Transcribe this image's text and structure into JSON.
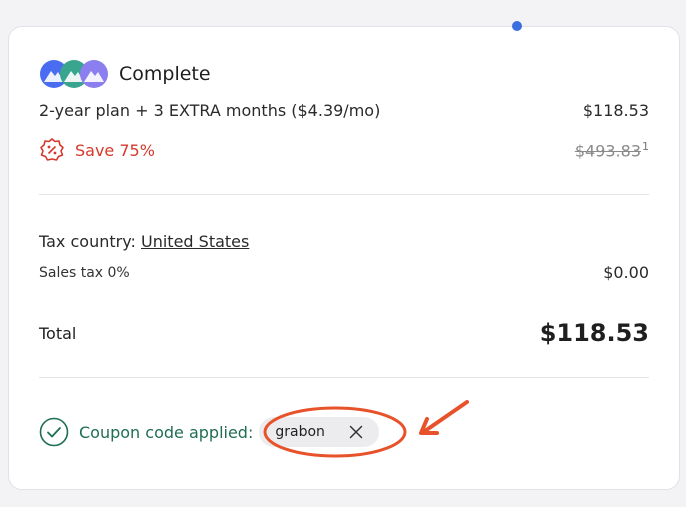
{
  "plan": {
    "name": "Complete",
    "description": "2-year plan + 3 EXTRA months ($4.39/mo)",
    "price": "$118.53",
    "save_label": "Save 75%",
    "original_price": "$493.83",
    "footnote": "1"
  },
  "tax": {
    "country_label": "Tax country:",
    "country_value": "United States",
    "sales_tax_label": "Sales tax 0%",
    "sales_tax_value": "$0.00"
  },
  "total": {
    "label": "Total",
    "value": "$118.53"
  },
  "coupon": {
    "status": "Coupon code applied:",
    "code": "grabon"
  },
  "colors": {
    "save_red": "#d5392b",
    "coupon_green": "#1f6e52",
    "annotation_orange": "#e8522a"
  }
}
